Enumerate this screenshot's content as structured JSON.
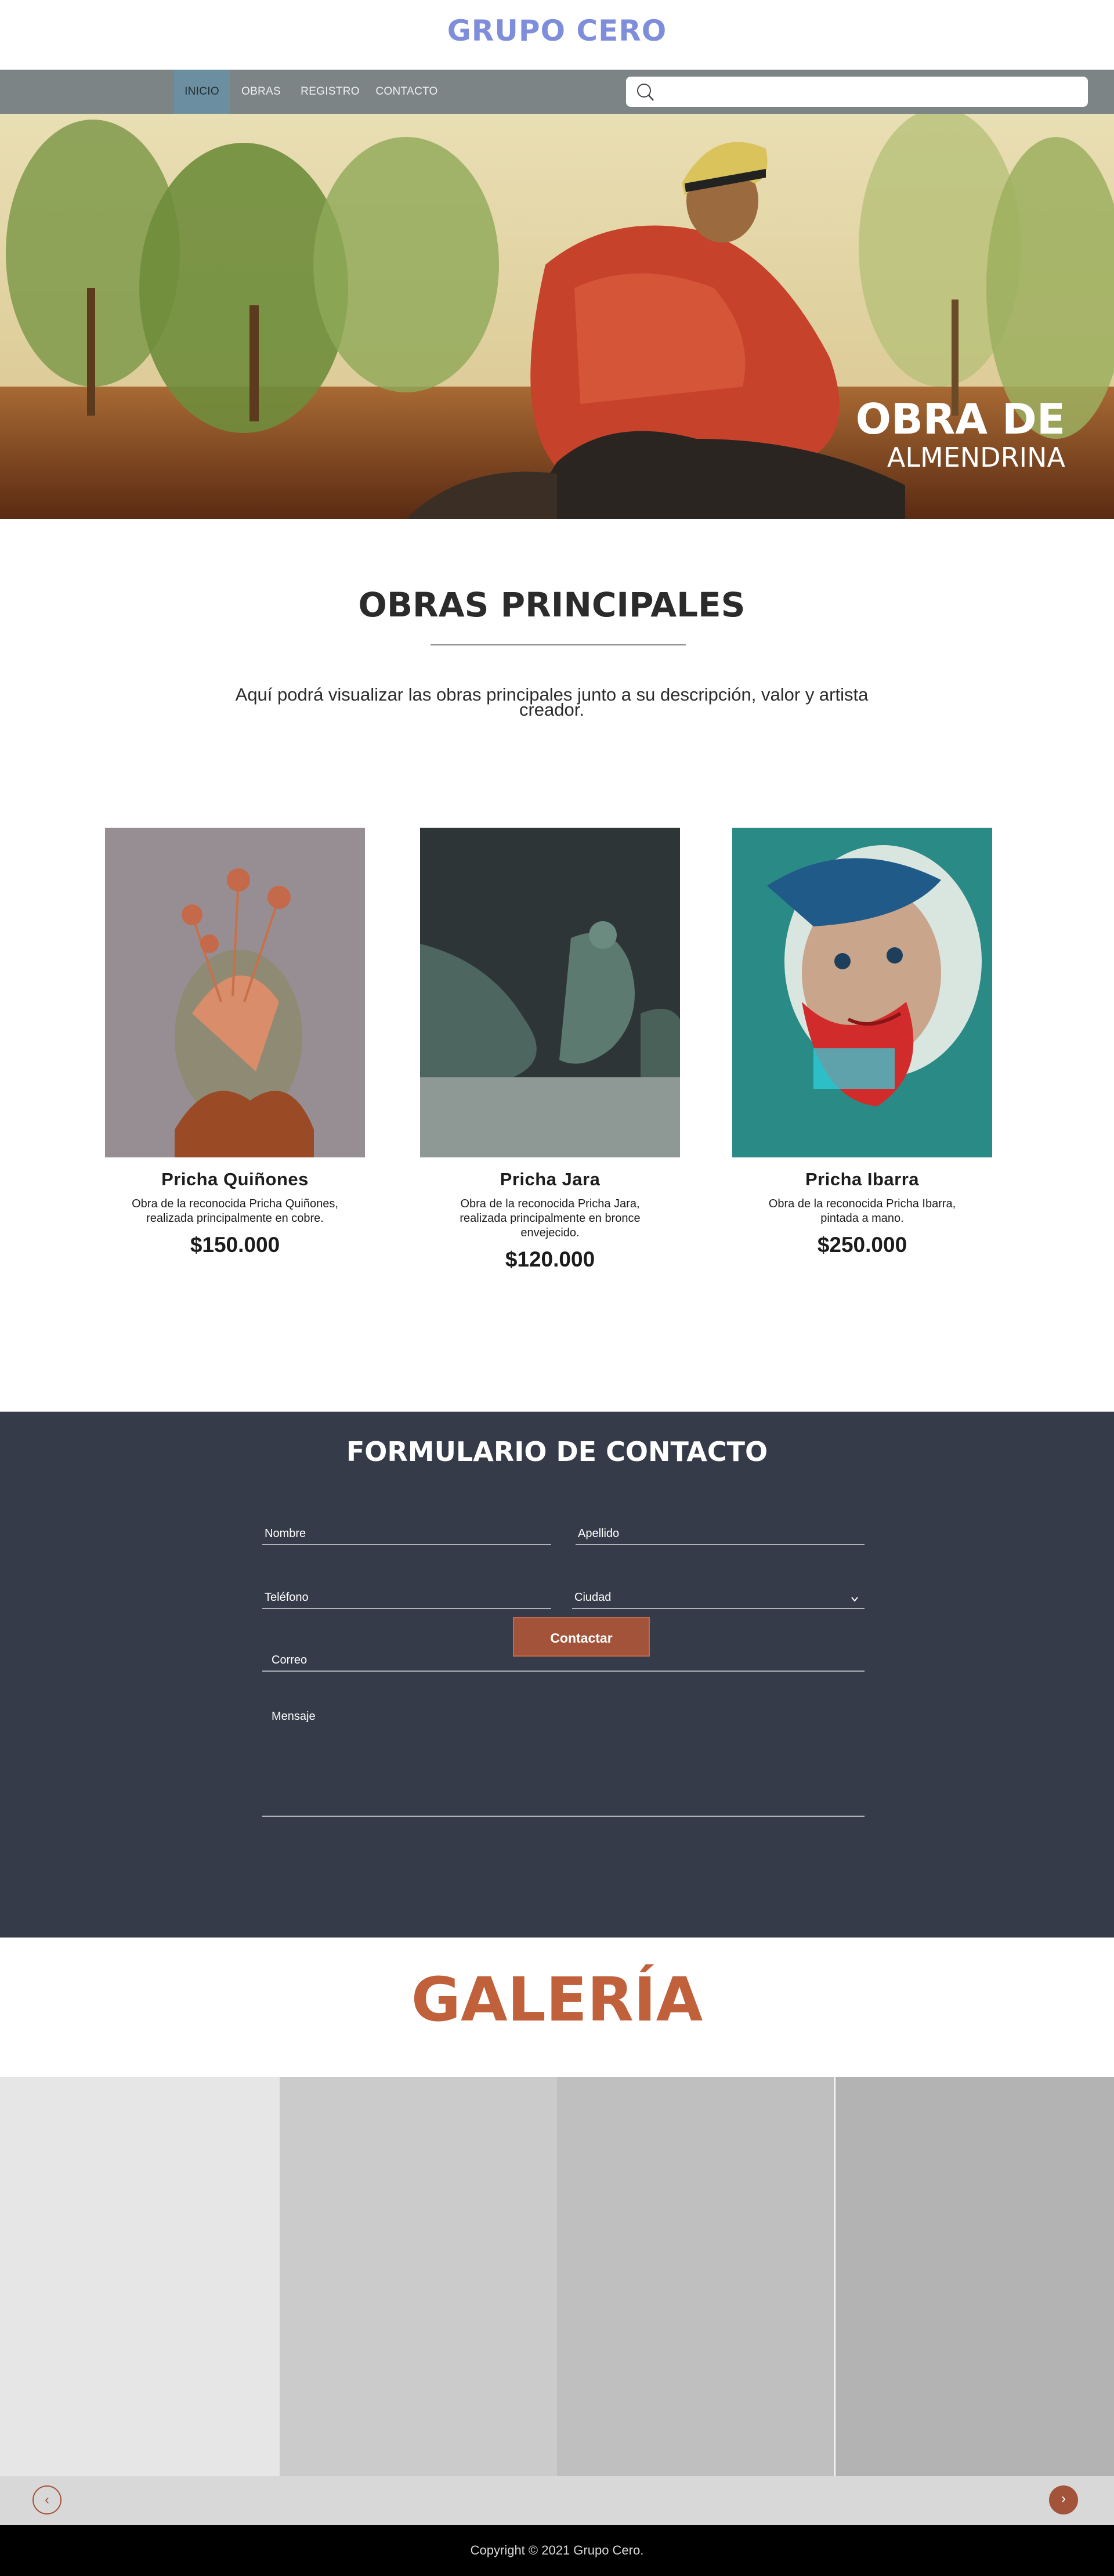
{
  "brand": {
    "title": "GRUPO CERO"
  },
  "nav": {
    "items": [
      {
        "label": "INICIO",
        "active": true
      },
      {
        "label": "OBRAS",
        "active": false
      },
      {
        "label": "REGISTRO",
        "active": false
      },
      {
        "label": "CONTACTO",
        "active": false
      }
    ],
    "search_placeholder": "",
    "search_icon": "search-icon"
  },
  "hero": {
    "line1": "OBRA DE",
    "line2": "ALMENDRINA"
  },
  "works": {
    "title": "OBRAS PRINCIPALES",
    "description": "Aquí podrá visualizar las obras principales junto a su descripción, valor y artista creador.",
    "items": [
      {
        "name": "Pricha Quiñones",
        "description": "Obra de la reconocida Pricha Quiñones, realizada principalmente en cobre.",
        "price": "$150.000"
      },
      {
        "name": "Pricha Jara",
        "description": "Obra de la reconocida Pricha Jara, realizada principalmente en bronce envejecido.",
        "price": "$120.000"
      },
      {
        "name": "Pricha Ibarra",
        "description": "Obra de la reconocida Pricha Ibarra, pintada a mano.",
        "price": "$250.000"
      }
    ]
  },
  "contact": {
    "title": "FORMULARIO DE CONTACTO",
    "fields": {
      "nombre": "Nombre",
      "apellido": "Apellido",
      "telefono": "Teléfono",
      "ciudad": "Ciudad",
      "correo": "Correo",
      "mensaje": "Mensaje"
    },
    "submit_label": "Contactar"
  },
  "gallery": {
    "title": "GALERÍA",
    "prev_icon": "chevron-left-icon",
    "next_icon": "chevron-right-icon",
    "prev_glyph": "‹",
    "next_glyph": "›"
  },
  "footer": {
    "copyright": "Copyright © 2021 Grupo Cero."
  },
  "colors": {
    "brand": "#7f8edb",
    "nav_bg": "#7c8485",
    "contact_bg": "#353b48",
    "accent": "#a3533a",
    "gallery_title": "#c0613c"
  }
}
